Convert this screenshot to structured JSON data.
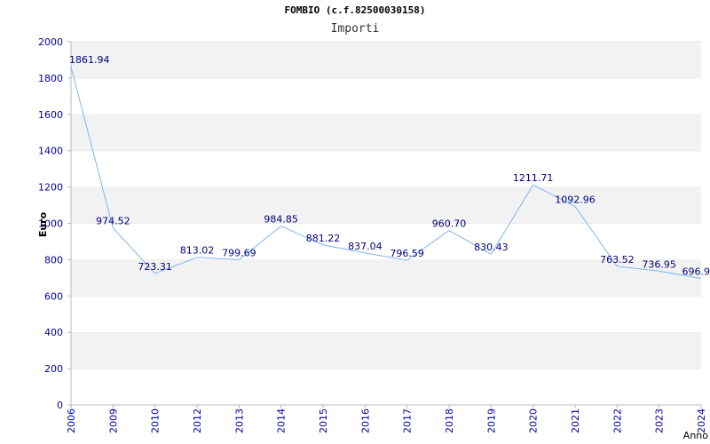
{
  "chart_data": {
    "type": "line",
    "title": "FOMBIO (c.f.82500030158)",
    "subtitle": "Importi",
    "xlabel": "Anno",
    "ylabel": "Euro",
    "ylim": [
      0,
      2000
    ],
    "y_ticks": [
      "0",
      "200",
      "400",
      "600",
      "800",
      "1000",
      "1200",
      "1400",
      "1600",
      "1800",
      "2000"
    ],
    "grid": "horizontal bands",
    "colors": {
      "line": "#7eb6f0",
      "tick_text": "#0000aa",
      "label_text": "#000080",
      "band": "#f2f2f2",
      "axis": "#bbbbbb"
    },
    "points": [
      {
        "x": "2006",
        "y": 1861.94,
        "label": "1861.94"
      },
      {
        "x": "2009",
        "y": 974.52,
        "label": "974.52"
      },
      {
        "x": "2010",
        "y": 723.31,
        "label": "723.31"
      },
      {
        "x": "2012",
        "y": 813.02,
        "label": "813.02"
      },
      {
        "x": "2013",
        "y": 799.69,
        "label": "799.69"
      },
      {
        "x": "2014",
        "y": 984.85,
        "label": "984.85"
      },
      {
        "x": "2015",
        "y": 881.22,
        "label": "881.22"
      },
      {
        "x": "2016",
        "y": 837.04,
        "label": "837.04"
      },
      {
        "x": "2017",
        "y": 796.59,
        "label": "796.59"
      },
      {
        "x": "2018",
        "y": 960.7,
        "label": "960.70"
      },
      {
        "x": "2019",
        "y": 830.43,
        "label": "830.43"
      },
      {
        "x": "2020",
        "y": 1211.71,
        "label": "1211.71"
      },
      {
        "x": "2021",
        "y": 1092.96,
        "label": "1092.96"
      },
      {
        "x": "2022",
        "y": 763.52,
        "label": "763.52"
      },
      {
        "x": "2023",
        "y": 736.95,
        "label": "736.95"
      },
      {
        "x": "2024",
        "y": 696.9,
        "label": "696.9"
      }
    ]
  }
}
